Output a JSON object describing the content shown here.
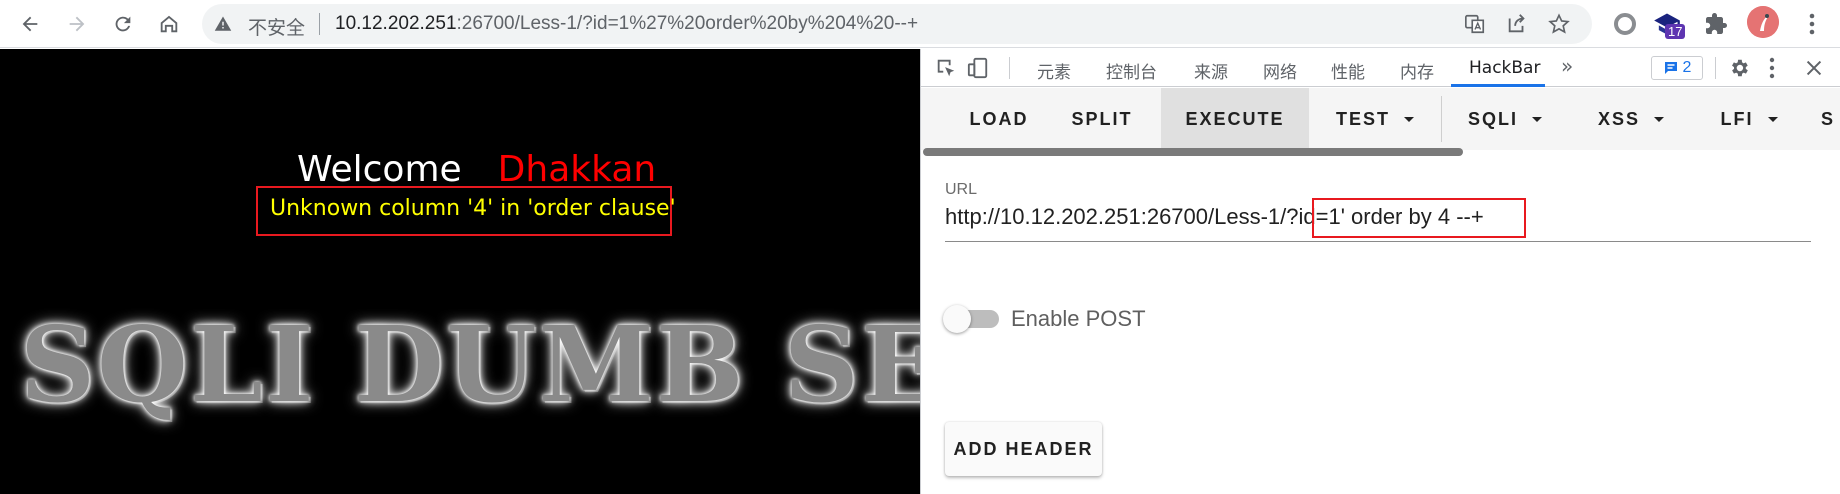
{
  "browser": {
    "insecure_label": "不安全",
    "url_host": "10.12.202.251",
    "url_rest": ":26700/Less-1/?id=1%27%20order%20by%204%20--+",
    "extension_badge": "17",
    "icons": [
      "back-icon",
      "forward-icon",
      "reload-icon",
      "home-icon",
      "warning-icon",
      "translate-icon",
      "share-icon",
      "star-icon",
      "extension-circle-icon",
      "graduation-cap-icon",
      "puzzle-icon",
      "avatar"
    ]
  },
  "page": {
    "welcome": "Welcome",
    "name": "Dhakkan",
    "error": "Unknown column '4' in 'order clause'",
    "banner": "SQLI DUMB SERIES",
    "colors": {
      "name": "#ff0000",
      "error": "#ffff00",
      "highlight": "#e8191f"
    }
  },
  "devtools": {
    "tabs": [
      "元素",
      "控制台",
      "来源",
      "网络",
      "性能",
      "内存",
      "HackBar"
    ],
    "active_tab": "HackBar",
    "more_label": "»",
    "issues_count": "2"
  },
  "hackbar": {
    "buttons": {
      "load": "LOAD",
      "split": "SPLIT",
      "execute": "EXECUTE",
      "test": "TEST",
      "sqli": "SQLI",
      "xss": "XSS",
      "lfi": "LFI",
      "more": "S"
    },
    "url_label": "URL",
    "url_value": "http://10.12.202.251:26700/Less-1/?id=1' order by 4 --+",
    "enable_post_label": "Enable POST",
    "enable_post": false,
    "add_header_label": "ADD HEADER"
  }
}
